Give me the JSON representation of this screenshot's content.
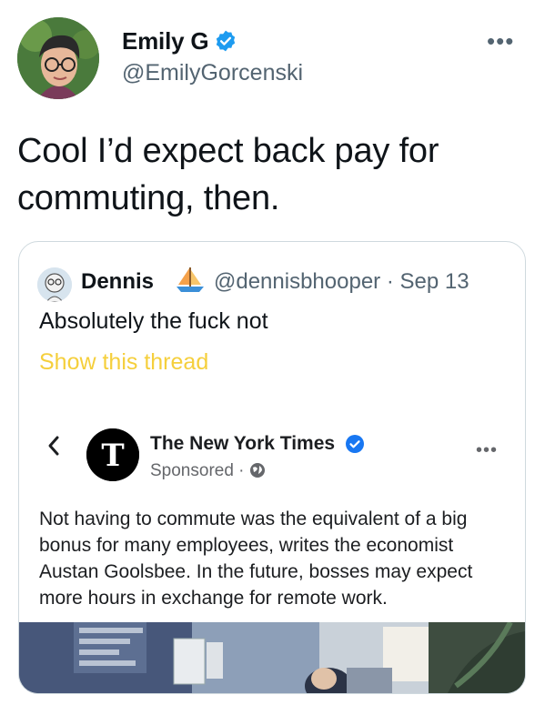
{
  "tweet": {
    "author_name": "Emily G",
    "author_handle": "@EmilyGorcenski",
    "more_label": "•••",
    "text": "Cool I’d expect back pay for commuting, then."
  },
  "quote": {
    "author_name": "Dennis",
    "author_emoji": "sailboat",
    "author_handle": "@dennisbhooper · Sep 13",
    "text": "Absolutely the fuck not",
    "show_thread_label": "Show this thread",
    "ad": {
      "advertiser": "The New York Times",
      "sponsored_label": "Sponsored ·",
      "more_label": "•••",
      "body": "Not having to commute was the equivalent of a big bonus for many employees, writes the economist Austan Goolsbee. In the future, bosses may expect more hours in exchange for remote work."
    }
  },
  "colors": {
    "verified": "#1d9bf0",
    "fb_verified": "#1877f2",
    "show_thread": "#f5cf3c"
  }
}
